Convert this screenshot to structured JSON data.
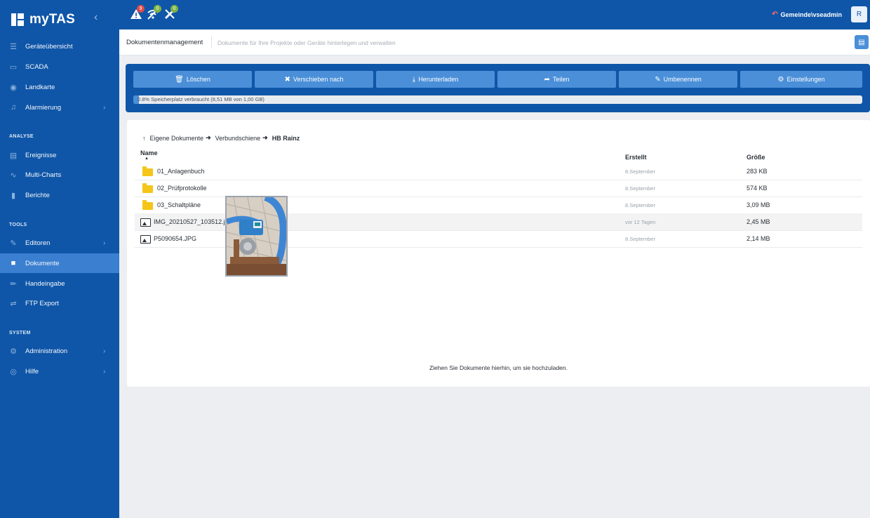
{
  "app": {
    "name": "myTAS"
  },
  "topbar": {
    "alerts": [
      {
        "icon": "warning-icon",
        "count": "9",
        "badge_color": "#e04b4b"
      },
      {
        "icon": "no-connection-icon",
        "count": "0",
        "badge_color": "#7cb342"
      },
      {
        "icon": "tools-off-icon",
        "count": "0",
        "badge_color": "#7cb342"
      }
    ],
    "user": "Gemeinde\\vseadmin",
    "avatar_letter": "R"
  },
  "sidebar": {
    "items": [
      {
        "label": "Geräteübersicht",
        "icon": "list-icon"
      },
      {
        "label": "SCADA",
        "icon": "monitor-icon"
      },
      {
        "label": "Landkarte",
        "icon": "map-pin-icon"
      },
      {
        "label": "Alarmierung",
        "icon": "bell-icon",
        "has_submenu": true
      }
    ],
    "sections": [
      {
        "title": "ANALYSE",
        "items": [
          {
            "label": "Ereignisse",
            "icon": "events-icon"
          },
          {
            "label": "Multi-Charts",
            "icon": "chart-icon"
          },
          {
            "label": "Berichte",
            "icon": "report-icon"
          }
        ]
      },
      {
        "title": "TOOLS",
        "items": [
          {
            "label": "Editoren",
            "icon": "edit-icon",
            "has_submenu": true
          },
          {
            "label": "Dokumente",
            "icon": "folder-open-icon",
            "active": true
          },
          {
            "label": "Handeingabe",
            "icon": "pencil-icon"
          },
          {
            "label": "FTP Export",
            "icon": "shuffle-icon"
          }
        ]
      },
      {
        "title": "SYSTEM",
        "items": [
          {
            "label": "Administration",
            "icon": "gear-icon",
            "has_submenu": true
          },
          {
            "label": "Hilfe",
            "icon": "help-icon",
            "has_submenu": true
          }
        ]
      }
    ]
  },
  "header": {
    "title": "Dokumentenmanagement",
    "subtitle": "Dokumente für Ihre Projekte oder Geräte hinterlegen und verwalten"
  },
  "toolbar": {
    "buttons": [
      {
        "label": "Löschen",
        "icon": "trash-icon"
      },
      {
        "label": "Verschieben nach",
        "icon": "move-icon"
      },
      {
        "label": "Herunterladen",
        "icon": "download-icon"
      },
      {
        "label": "Teilen",
        "icon": "share-icon"
      },
      {
        "label": "Umbenennen",
        "icon": "rename-icon"
      },
      {
        "label": "Einstellungen",
        "icon": "settings-icon"
      }
    ],
    "storage": {
      "text": "0.8% Speicherplatz verbraucht (8,51 MB von 1,00 GB)",
      "fraction": 0.008
    },
    "colors": {
      "panel": "#0f56a8",
      "button": "#4a8fd8"
    }
  },
  "breadcrumb": [
    "Eigene Dokumente",
    "Verbundschiene",
    "HB Rainz"
  ],
  "table": {
    "columns": {
      "name": "Name",
      "created": "Erstellt",
      "size": "Größe"
    },
    "rows": [
      {
        "type": "folder",
        "name": "01_Anlagenbuch",
        "created": "8.September",
        "size": "283 KB"
      },
      {
        "type": "folder",
        "name": "02_Prüfprotokolle",
        "created": "8.September",
        "size": "574 KB"
      },
      {
        "type": "folder",
        "name": "03_Schaltpläne",
        "created": "8.September",
        "size": "3,09 MB"
      },
      {
        "type": "image",
        "name": "IMG_20210527_103512.jpg",
        "created": "vor 12 Tagen",
        "size": "2,45 MB",
        "hovered": true
      },
      {
        "type": "image",
        "name": "P5090654.JPG",
        "created": "8.September",
        "size": "2,14 MB"
      }
    ]
  },
  "dropzone": {
    "text": "Ziehen Sie Dokumente hierhin, um sie hochzuladen."
  }
}
